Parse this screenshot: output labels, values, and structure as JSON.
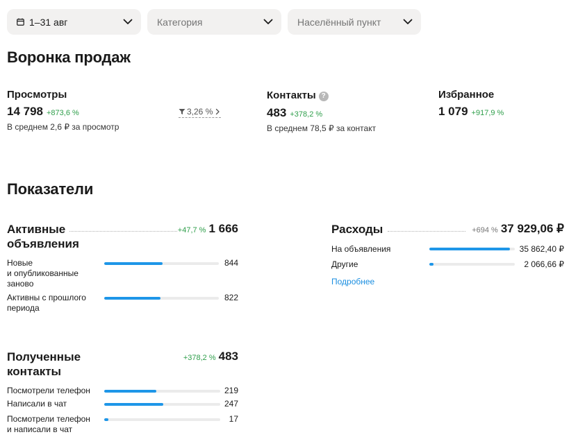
{
  "filters": {
    "date": "1–31 авг",
    "category": "Категория",
    "city": "Населённый пункт"
  },
  "funnel": {
    "title": "Воронка продаж",
    "views": {
      "label": "Просмотры",
      "value": "14 798",
      "delta": "+873,6 %",
      "sub": "В среднем 2,6 ₽ за просмотр"
    },
    "conversion": "3,26 %",
    "contacts": {
      "label": "Контакты",
      "help": "?",
      "value": "483",
      "delta": "+378,2 %",
      "sub": "В среднем 78,5 ₽ за контакт"
    },
    "favorites": {
      "label": "Избранное",
      "value": "1 079",
      "delta": "+917,9 %"
    }
  },
  "metrics": {
    "title": "Показатели",
    "active_ads": {
      "title_line1": "Активные",
      "title_line2": "объявления",
      "delta": "+47,7 %",
      "total": "1 666",
      "rows": [
        {
          "label_line1": "Новые",
          "label_line2": "и опубликованные",
          "label_line3": "заново",
          "value": "844",
          "fraction": 0.51
        },
        {
          "label_line1": "Активны с прошлого",
          "label_line2": "периода",
          "value": "822",
          "fraction": 0.49
        }
      ]
    },
    "expenses": {
      "title": "Расходы",
      "delta": "+694 %",
      "total": "37 929,06 ₽",
      "rows": [
        {
          "label": "На объявления",
          "value": "35 862,40 ₽",
          "fraction": 0.945
        },
        {
          "label": "Другие",
          "value": "2 066,66 ₽",
          "fraction": 0.05
        }
      ],
      "more": "Подробнее"
    },
    "contacts": {
      "title_line1": "Полученные",
      "title_line2": "контакты",
      "delta": "+378,2 %",
      "total": "483",
      "rows": [
        {
          "label_line1": "Посмотрели телефон",
          "value": "219",
          "fraction": 0.45
        },
        {
          "label_line1": "Написали в чат",
          "value": "247",
          "fraction": 0.51
        },
        {
          "label_line1": "Посмотрели телефон",
          "label_line2": "и написали в чат",
          "value": "17",
          "fraction": 0.035
        }
      ]
    }
  },
  "colors": {
    "accent": "#1e96e8",
    "positive": "#2e9e4a",
    "track": "#ebebeb",
    "filter_bg": "#f2f1f0"
  }
}
